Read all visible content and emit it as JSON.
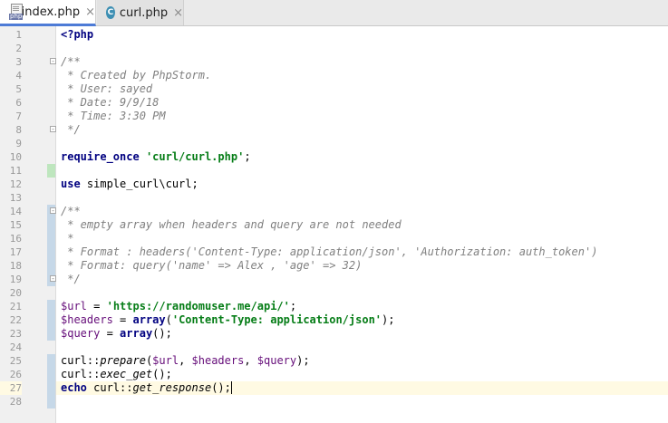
{
  "tabs": [
    {
      "label": "index.php",
      "icon": "php-file-icon",
      "active": true
    },
    {
      "label": "curl.php",
      "icon": "class-c-icon",
      "active": false
    }
  ],
  "icons": {
    "close": "×",
    "class_letter": "C",
    "php_badge": "php"
  },
  "editor": {
    "lines": [
      {
        "n": "1",
        "tokens": [
          [
            "ph-tag",
            "<?php"
          ]
        ]
      },
      {
        "n": "2",
        "tokens": []
      },
      {
        "n": "3",
        "tokens": [
          [
            "cmt",
            "/**"
          ]
        ]
      },
      {
        "n": "4",
        "tokens": [
          [
            "cmt",
            " * Created by PhpStorm."
          ]
        ]
      },
      {
        "n": "5",
        "tokens": [
          [
            "cmt",
            " * User: sayed"
          ]
        ]
      },
      {
        "n": "6",
        "tokens": [
          [
            "cmt",
            " * Date: 9/9/18"
          ]
        ]
      },
      {
        "n": "7",
        "tokens": [
          [
            "cmt",
            " * Time: 3:30 PM"
          ]
        ]
      },
      {
        "n": "8",
        "tokens": [
          [
            "cmt",
            " */"
          ]
        ]
      },
      {
        "n": "9",
        "tokens": []
      },
      {
        "n": "10",
        "tokens": [
          [
            "kw",
            "require_once"
          ],
          [
            "plain",
            " "
          ],
          [
            "str",
            "'curl/curl.php'"
          ],
          [
            "plain",
            ";"
          ]
        ]
      },
      {
        "n": "11",
        "tokens": []
      },
      {
        "n": "12",
        "tokens": [
          [
            "kw",
            "use"
          ],
          [
            "plain",
            " simple_curl\\curl;"
          ]
        ]
      },
      {
        "n": "13",
        "tokens": []
      },
      {
        "n": "14",
        "tokens": [
          [
            "cmt",
            "/**"
          ]
        ]
      },
      {
        "n": "15",
        "tokens": [
          [
            "cmt",
            " * empty array when headers and query are not needed"
          ]
        ]
      },
      {
        "n": "16",
        "tokens": [
          [
            "cmt",
            " *"
          ]
        ]
      },
      {
        "n": "17",
        "tokens": [
          [
            "cmt",
            " * Format : headers('Content-Type: application/json', 'Authorization: auth_token')"
          ]
        ]
      },
      {
        "n": "18",
        "tokens": [
          [
            "cmt",
            " * Format: query('name' => Alex , 'age' => 32)"
          ]
        ]
      },
      {
        "n": "19",
        "tokens": [
          [
            "cmt",
            " */"
          ]
        ]
      },
      {
        "n": "20",
        "tokens": []
      },
      {
        "n": "21",
        "tokens": [
          [
            "var",
            "$url"
          ],
          [
            "plain",
            " = "
          ],
          [
            "str",
            "'https://randomuser.me/api/'"
          ],
          [
            "plain",
            ";"
          ]
        ]
      },
      {
        "n": "22",
        "tokens": [
          [
            "var",
            "$headers"
          ],
          [
            "plain",
            " = "
          ],
          [
            "kw",
            "array"
          ],
          [
            "plain",
            "("
          ],
          [
            "str",
            "'Content-Type: application/json'"
          ],
          [
            "plain",
            ");"
          ]
        ]
      },
      {
        "n": "23",
        "tokens": [
          [
            "var",
            "$query"
          ],
          [
            "plain",
            " = "
          ],
          [
            "kw",
            "array"
          ],
          [
            "plain",
            "();"
          ]
        ]
      },
      {
        "n": "24",
        "tokens": []
      },
      {
        "n": "25",
        "tokens": [
          [
            "plain",
            "curl::"
          ],
          [
            "fn-i",
            "prepare"
          ],
          [
            "plain",
            "("
          ],
          [
            "var",
            "$url"
          ],
          [
            "plain",
            ", "
          ],
          [
            "var",
            "$headers"
          ],
          [
            "plain",
            ", "
          ],
          [
            "var",
            "$query"
          ],
          [
            "plain",
            ");"
          ]
        ]
      },
      {
        "n": "26",
        "tokens": [
          [
            "plain",
            "curl::"
          ],
          [
            "fn-i",
            "exec_get"
          ],
          [
            "plain",
            "();"
          ]
        ]
      },
      {
        "n": "27",
        "tokens": [
          [
            "kw",
            "echo"
          ],
          [
            "plain",
            " curl::"
          ],
          [
            "fn-i",
            "get_response"
          ],
          [
            "plain",
            "();"
          ]
        ]
      },
      {
        "n": "28",
        "tokens": []
      }
    ],
    "caret_line": "27",
    "change_marks": {
      "mod": [
        "14",
        "15",
        "16",
        "17",
        "18",
        "19",
        "21",
        "22",
        "23",
        "25",
        "26",
        "27",
        "28"
      ],
      "add": [
        "11"
      ]
    },
    "fold_markers": [
      "3",
      "8",
      "14",
      "19"
    ]
  },
  "colors": {
    "keyword": "#000080",
    "string": "#067d17",
    "comment": "#808080",
    "variable": "#660e7a",
    "active_tab_underline": "#4d7bd6"
  }
}
